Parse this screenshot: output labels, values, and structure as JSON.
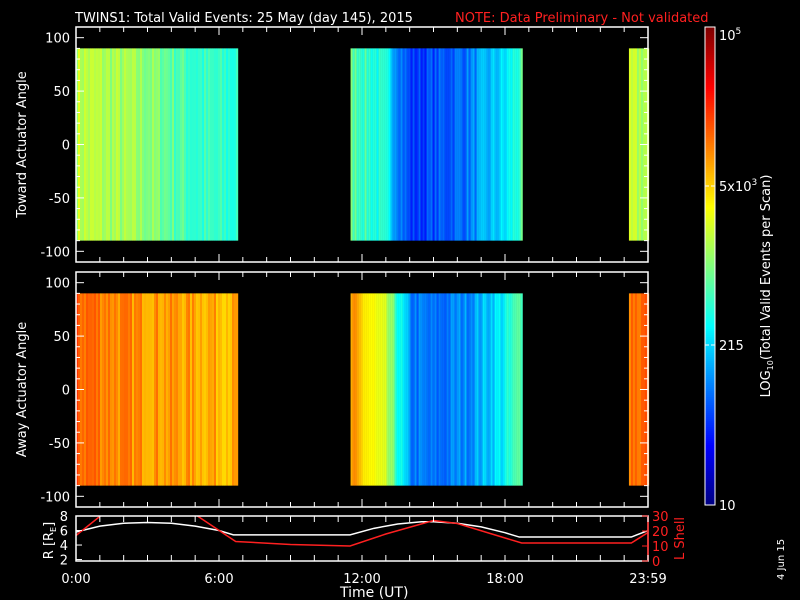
{
  "title": "TWINS1: Total Valid Events: 25 May (day 145), 2015",
  "note": "NOTE: Data Preliminary - Not validated",
  "date_stamp": "4 Jun 15",
  "chart_data": [
    {
      "type": "heatmap",
      "name": "toward",
      "ylabel": "Toward Actuator Angle",
      "ylim": [
        -110,
        110
      ],
      "yticks": [
        "100",
        "50",
        "0",
        "-50",
        "-100"
      ],
      "ytick_values": [
        100,
        50,
        0,
        -50,
        -100
      ],
      "data_angle_range": [
        -90,
        90
      ],
      "segments": [
        {
          "start_h": 0.0,
          "end_h": 6.72,
          "log_profile": [
            [
              0,
              3.25
            ],
            [
              3,
              3.05
            ],
            [
              5,
              2.7
            ],
            [
              6.72,
              2.65
            ]
          ]
        },
        {
          "start_h": 11.52,
          "end_h": 18.68,
          "log_profile": [
            [
              11.52,
              2.9
            ],
            [
              13,
              2.5
            ],
            [
              14,
              1.7
            ],
            [
              15,
              1.8
            ],
            [
              16.5,
              2.0
            ],
            [
              18,
              2.4
            ],
            [
              18.68,
              2.8
            ]
          ]
        },
        {
          "start_h": 23.2,
          "end_h": 24.0,
          "log_profile": [
            [
              23.2,
              3.2
            ],
            [
              24,
              3.2
            ]
          ]
        }
      ]
    },
    {
      "type": "heatmap",
      "name": "away",
      "ylabel": "Away Actuator Angle",
      "ylim": [
        -110,
        110
      ],
      "yticks": [
        "100",
        "50",
        "0",
        "-50",
        "-100"
      ],
      "ytick_values": [
        100,
        50,
        0,
        -50,
        -100
      ],
      "data_angle_range": [
        -90,
        90
      ],
      "segments": [
        {
          "start_h": 0.0,
          "end_h": 6.72,
          "log_profile": [
            [
              0,
              4.15
            ],
            [
              2,
              3.95
            ],
            [
              6.72,
              3.8
            ]
          ]
        },
        {
          "start_h": 11.52,
          "end_h": 18.68,
          "log_profile": [
            [
              11.52,
              3.85
            ],
            [
              13,
              3.2
            ],
            [
              14,
              2.0
            ],
            [
              15,
              1.9
            ],
            [
              16.5,
              2.1
            ],
            [
              18,
              2.5
            ],
            [
              18.68,
              2.9
            ]
          ]
        },
        {
          "start_h": 23.2,
          "end_h": 24.0,
          "log_profile": [
            [
              23.2,
              4.1
            ],
            [
              24,
              4.1
            ]
          ]
        }
      ]
    },
    {
      "type": "line",
      "name": "orbit",
      "xlabel": "Time (UT)",
      "xticks": [
        "0:00",
        "6:00",
        "12:00",
        "18:00",
        "23:59"
      ],
      "xtick_hours": [
        0,
        6,
        12,
        18,
        24
      ],
      "ylabel_left": "R [R",
      "ylabel_left_sub": "E",
      "ylabel_left_close": "]",
      "yticks_left": [
        "2",
        "4",
        "6",
        "8"
      ],
      "ylim_left": [
        1.8,
        8.0
      ],
      "ylabel_right": "L Shell",
      "yticks_right": [
        "0",
        "10",
        "20",
        "30"
      ],
      "ylim_right": [
        0,
        30
      ],
      "series": [
        {
          "name": "R",
          "color": "#ffffff",
          "x": [
            0,
            1,
            2,
            3,
            4,
            5,
            6,
            6.6,
            11.5,
            12.5,
            13.5,
            14.5,
            15,
            16,
            17,
            18,
            18.6,
            23.3,
            24
          ],
          "y": [
            5.8,
            6.6,
            7.0,
            7.1,
            7.0,
            6.6,
            6.0,
            5.4,
            5.4,
            6.3,
            6.9,
            7.2,
            7.2,
            7.0,
            6.5,
            5.7,
            5.1,
            5.1,
            6.0
          ]
        },
        {
          "name": "L Shell",
          "color": "#ff2020",
          "x": [
            0,
            1.1,
            null,
            5,
            6.7,
            9,
            11.5,
            13,
            15,
            16,
            18.7,
            23.3,
            24
          ],
          "y": [
            17,
            31,
            null,
            31,
            13,
            11,
            10,
            18,
            27,
            25,
            12,
            12,
            19
          ]
        }
      ]
    },
    {
      "type": "colorbar",
      "label": "LOG",
      "label_sub": "10",
      "label_rest": "(Total Valid Events per Scan)",
      "ticks": [
        "10",
        "215",
        "5x10",
        "10"
      ],
      "tick_sup": [
        "",
        "",
        "3",
        "5"
      ],
      "tick_sub": [
        "",
        "",
        "",
        ""
      ],
      "range_log": [
        1,
        5
      ]
    }
  ]
}
